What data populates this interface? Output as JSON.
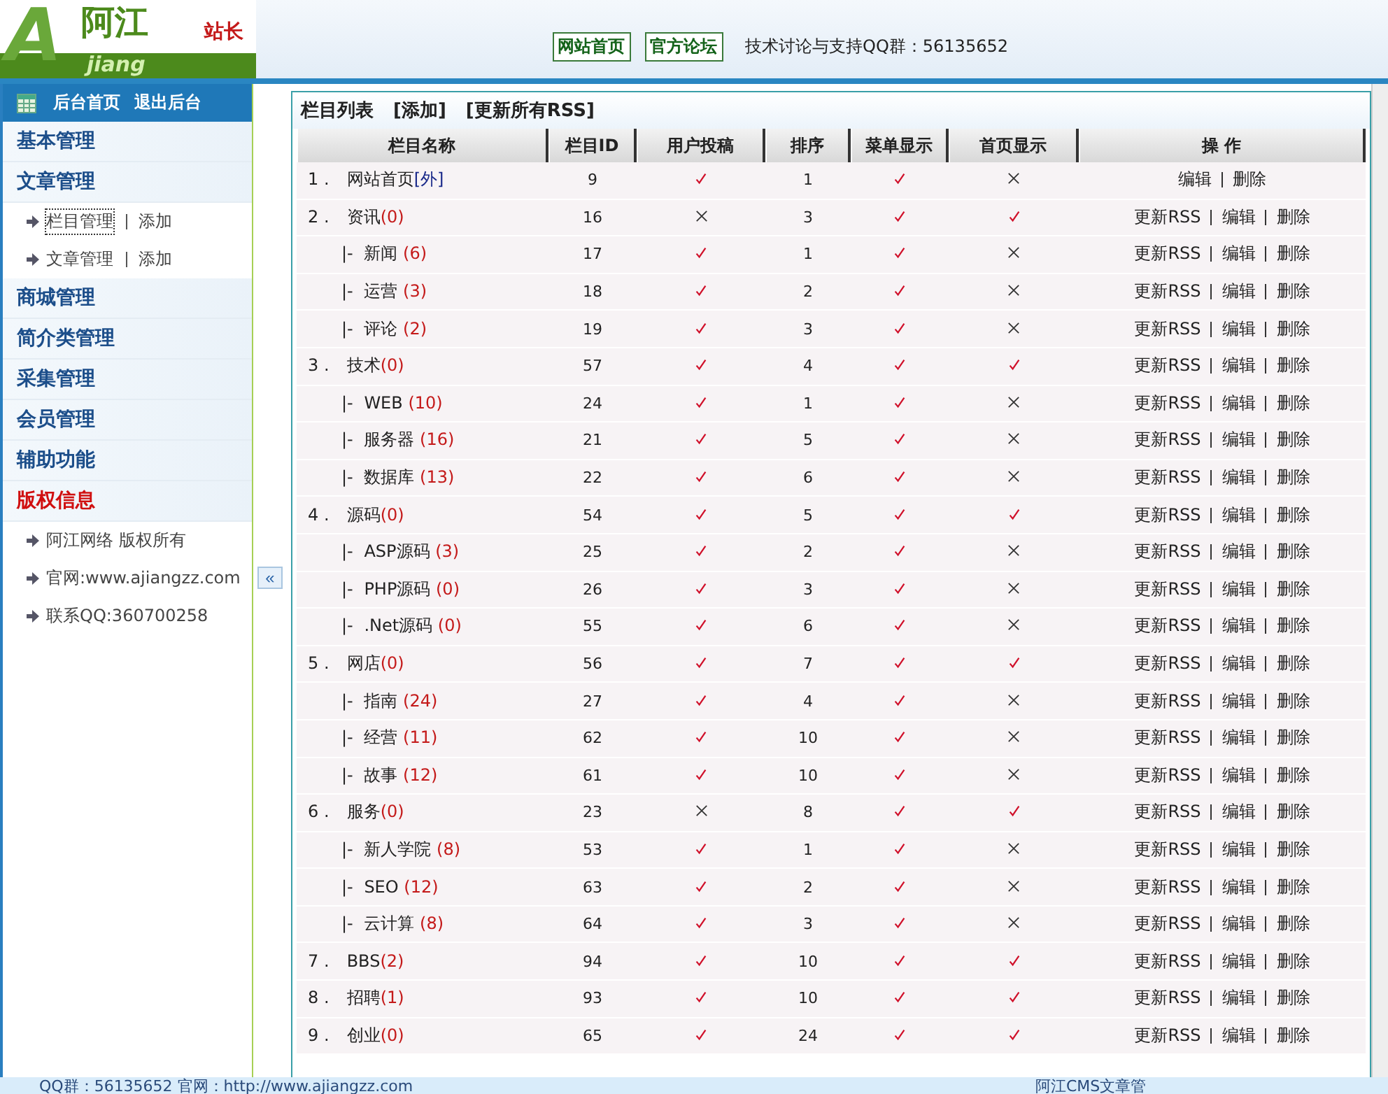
{
  "header": {
    "logo": {
      "letter": "A",
      "name": "阿江",
      "latin": "jiang",
      "badge": "站长"
    },
    "links": [
      "网站首页",
      "官方论坛"
    ],
    "support": "技术讨论与支持QQ群：56135652"
  },
  "sidebar": {
    "top_links": [
      "后台首页",
      "退出后台"
    ],
    "groups": [
      {
        "label": "基本管理",
        "highlighted": false
      },
      {
        "label": "文章管理",
        "highlighted": false,
        "children": [
          {
            "links": [
              {
                "label": "栏目管理",
                "selected": true
              },
              {
                "label": "添加",
                "selected": false
              }
            ]
          },
          {
            "links": [
              {
                "label": "文章管理",
                "selected": false
              },
              {
                "label": "添加",
                "selected": false
              }
            ]
          }
        ]
      },
      {
        "label": "商城管理",
        "highlighted": false
      },
      {
        "label": "简介类管理",
        "highlighted": false
      },
      {
        "label": "采集管理",
        "highlighted": false
      },
      {
        "label": "会员管理",
        "highlighted": false
      },
      {
        "label": "辅助功能",
        "highlighted": false
      },
      {
        "label": "版权信息",
        "highlighted": true,
        "notes": [
          "阿江网络 版权所有",
          "官网:www.ajiangzz.com",
          "联系QQ:360700258"
        ]
      }
    ]
  },
  "collapse_button": "«",
  "panel": {
    "title": "栏目列表",
    "actions": [
      "[添加]",
      "[更新所有RSS]"
    ],
    "table": {
      "columns": [
        "栏目名称",
        "栏目ID",
        "用户投稿",
        "排序",
        "菜单显示",
        "首页显示",
        "操 作"
      ],
      "rows": [
        {
          "index": "1 .",
          "name": "网站首页",
          "link": "[外]",
          "id": "9",
          "submit": true,
          "order": "1",
          "menu": true,
          "home": false,
          "ops": [
            "编辑",
            "删除"
          ]
        },
        {
          "index": "2 .",
          "name": "资讯",
          "suffix": "(0)",
          "id": "16",
          "submit": false,
          "order": "3",
          "menu": true,
          "home": true,
          "ops": [
            "更新RSS",
            "编辑",
            "删除"
          ],
          "children": [
            {
              "marker": "|-",
              "name": "新闻",
              "suffix": "(6)",
              "id": "17",
              "submit": true,
              "order": "1",
              "menu": true,
              "home": false,
              "ops": [
                "更新RSS",
                "编辑",
                "删除"
              ]
            },
            {
              "marker": "|-",
              "name": "运营",
              "suffix": "(3)",
              "id": "18",
              "submit": true,
              "order": "2",
              "menu": true,
              "home": false,
              "ops": [
                "更新RSS",
                "编辑",
                "删除"
              ]
            },
            {
              "marker": "|-",
              "name": "评论",
              "suffix": "(2)",
              "id": "19",
              "submit": true,
              "order": "3",
              "menu": true,
              "home": false,
              "ops": [
                "更新RSS",
                "编辑",
                "删除"
              ]
            }
          ]
        },
        {
          "index": "3 .",
          "name": "技术",
          "suffix": "(0)",
          "id": "57",
          "submit": true,
          "order": "4",
          "menu": true,
          "home": true,
          "ops": [
            "更新RSS",
            "编辑",
            "删除"
          ],
          "children": [
            {
              "marker": "|-",
              "name": "WEB",
              "suffix": "(10)",
              "id": "24",
              "submit": true,
              "order": "1",
              "menu": true,
              "home": false,
              "ops": [
                "更新RSS",
                "编辑",
                "删除"
              ]
            },
            {
              "marker": "|-",
              "name": "服务器",
              "suffix": "(16)",
              "id": "21",
              "submit": true,
              "order": "5",
              "menu": true,
              "home": false,
              "ops": [
                "更新RSS",
                "编辑",
                "删除"
              ]
            },
            {
              "marker": "|-",
              "name": "数据库",
              "suffix": "(13)",
              "id": "22",
              "submit": true,
              "order": "6",
              "menu": true,
              "home": false,
              "ops": [
                "更新RSS",
                "编辑",
                "删除"
              ]
            }
          ]
        },
        {
          "index": "4 .",
          "name": "源码",
          "suffix": "(0)",
          "id": "54",
          "submit": true,
          "order": "5",
          "menu": true,
          "home": true,
          "ops": [
            "更新RSS",
            "编辑",
            "删除"
          ],
          "children": [
            {
              "marker": "|-",
              "name": "ASP源码",
              "suffix": "(3)",
              "id": "25",
              "submit": true,
              "order": "2",
              "menu": true,
              "home": false,
              "ops": [
                "更新RSS",
                "编辑",
                "删除"
              ]
            },
            {
              "marker": "|-",
              "name": "PHP源码",
              "suffix": "(0)",
              "id": "26",
              "submit": true,
              "order": "3",
              "menu": true,
              "home": false,
              "ops": [
                "更新RSS",
                "编辑",
                "删除"
              ]
            },
            {
              "marker": "|-",
              "name": ".Net源码",
              "suffix": "(0)",
              "id": "55",
              "submit": true,
              "order": "6",
              "menu": true,
              "home": false,
              "ops": [
                "更新RSS",
                "编辑",
                "删除"
              ]
            }
          ]
        },
        {
          "index": "5 .",
          "name": "网店",
          "suffix": "(0)",
          "id": "56",
          "submit": true,
          "order": "7",
          "menu": true,
          "home": true,
          "ops": [
            "更新RSS",
            "编辑",
            "删除"
          ],
          "children": [
            {
              "marker": "|-",
              "name": "指南",
              "suffix": "(24)",
              "id": "27",
              "submit": true,
              "order": "4",
              "menu": true,
              "home": false,
              "ops": [
                "更新RSS",
                "编辑",
                "删除"
              ]
            },
            {
              "marker": "|-",
              "name": "经营",
              "suffix": "(11)",
              "id": "62",
              "submit": true,
              "order": "10",
              "menu": true,
              "home": false,
              "ops": [
                "更新RSS",
                "编辑",
                "删除"
              ]
            },
            {
              "marker": "|-",
              "name": "故事",
              "suffix": "(12)",
              "id": "61",
              "submit": true,
              "order": "10",
              "menu": true,
              "home": false,
              "ops": [
                "更新RSS",
                "编辑",
                "删除"
              ]
            }
          ]
        },
        {
          "index": "6 .",
          "name": "服务",
          "suffix": "(0)",
          "id": "23",
          "submit": false,
          "order": "8",
          "menu": true,
          "home": true,
          "ops": [
            "更新RSS",
            "编辑",
            "删除"
          ],
          "children": [
            {
              "marker": "|-",
              "name": "新人学院",
              "suffix": "(8)",
              "id": "53",
              "submit": true,
              "order": "1",
              "menu": true,
              "home": false,
              "ops": [
                "更新RSS",
                "编辑",
                "删除"
              ]
            },
            {
              "marker": "|-",
              "name": "SEO",
              "suffix": "(12)",
              "id": "63",
              "submit": true,
              "order": "2",
              "menu": true,
              "home": false,
              "ops": [
                "更新RSS",
                "编辑",
                "删除"
              ]
            },
            {
              "marker": "|-",
              "name": "云计算",
              "suffix": "(8)",
              "id": "64",
              "submit": true,
              "order": "3",
              "menu": true,
              "home": false,
              "ops": [
                "更新RSS",
                "编辑",
                "删除"
              ]
            }
          ]
        },
        {
          "index": "7 .",
          "name": "BBS",
          "suffix": "(2)",
          "id": "94",
          "submit": true,
          "order": "10",
          "menu": true,
          "home": true,
          "ops": [
            "更新RSS",
            "编辑",
            "删除"
          ]
        },
        {
          "index": "8 .",
          "name": "招聘",
          "suffix": "(1)",
          "id": "93",
          "submit": true,
          "order": "10",
          "menu": true,
          "home": true,
          "ops": [
            "更新RSS",
            "编辑",
            "删除"
          ]
        },
        {
          "index": "9 .",
          "name": "创业",
          "suffix": "(0)",
          "id": "65",
          "submit": true,
          "order": "24",
          "menu": true,
          "home": true,
          "ops": [
            "更新RSS",
            "编辑",
            "删除"
          ]
        }
      ]
    }
  },
  "footer": {
    "left": "QQ群：56135652 官网：http://www.ajiangzz.com",
    "right": "阿江CMS文章管"
  }
}
